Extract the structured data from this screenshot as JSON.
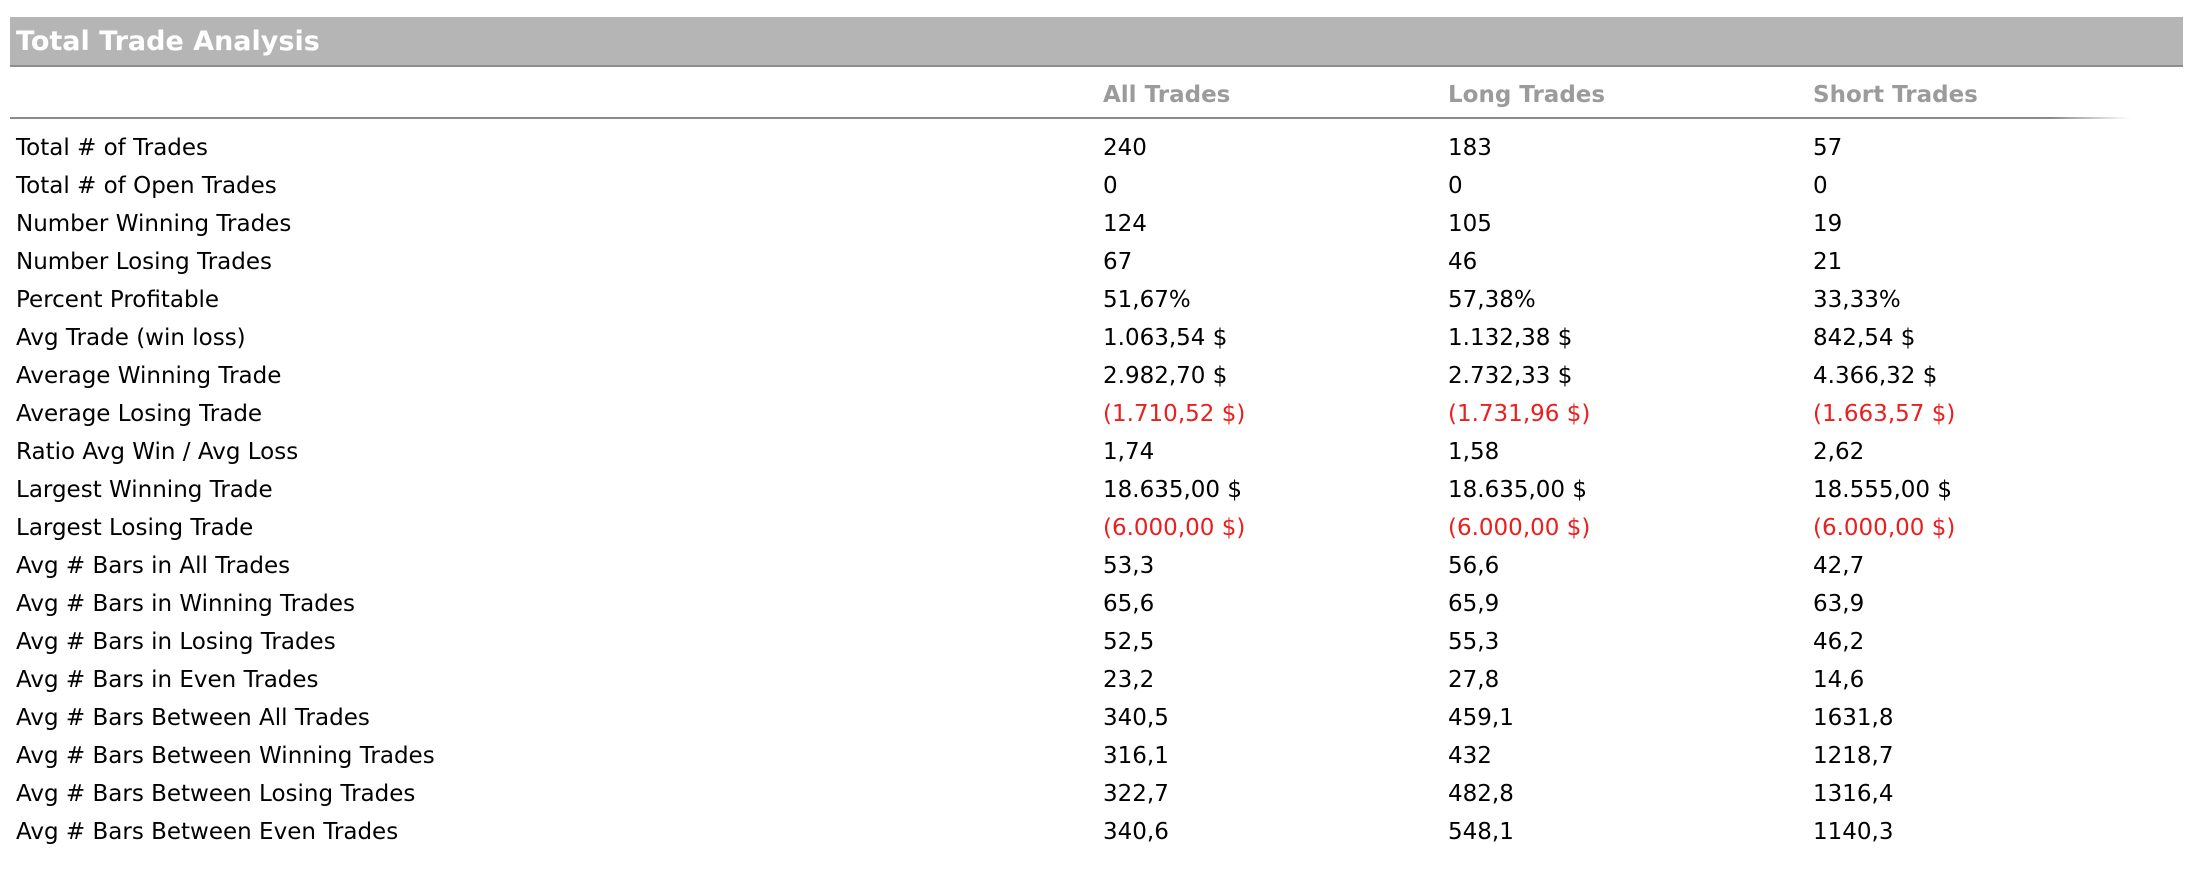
{
  "report": {
    "title": "Total Trade Analysis",
    "columns": [
      "All Trades",
      "Long Trades",
      "Short Trades"
    ],
    "negative_color": "#e8201f",
    "header_color": "#9b9b9b",
    "title_bar_color": "#b5b5b5",
    "rows": [
      {
        "label": "Total # of Trades",
        "values": [
          "240",
          "183",
          "57"
        ],
        "negative": false
      },
      {
        "label": "Total # of Open Trades",
        "values": [
          "0",
          "0",
          "0"
        ],
        "negative": false
      },
      {
        "label": "Number Winning Trades",
        "values": [
          "124",
          "105",
          "19"
        ],
        "negative": false
      },
      {
        "label": "Number Losing Trades",
        "values": [
          "67",
          "46",
          "21"
        ],
        "negative": false
      },
      {
        "label": "Percent Profitable",
        "values": [
          "51,67%",
          "57,38%",
          "33,33%"
        ],
        "negative": false
      },
      {
        "label": "Avg Trade (win  loss)",
        "values": [
          "1.063,54 $",
          "1.132,38 $",
          "842,54 $"
        ],
        "negative": false
      },
      {
        "label": "Average Winning Trade",
        "values": [
          "2.982,70 $",
          "2.732,33 $",
          "4.366,32 $"
        ],
        "negative": false
      },
      {
        "label": "Average Losing Trade",
        "values": [
          "(1.710,52 $)",
          "(1.731,96 $)",
          "(1.663,57 $)"
        ],
        "negative": true
      },
      {
        "label": "Ratio Avg Win / Avg Loss",
        "values": [
          "1,74",
          "1,58",
          "2,62"
        ],
        "negative": false
      },
      {
        "label": "Largest Winning Trade",
        "values": [
          "18.635,00 $",
          "18.635,00 $",
          "18.555,00 $"
        ],
        "negative": false
      },
      {
        "label": "Largest Losing Trade",
        "values": [
          "(6.000,00 $)",
          "(6.000,00 $)",
          "(6.000,00 $)"
        ],
        "negative": true
      },
      {
        "label": "Avg # Bars in All Trades",
        "values": [
          "53,3",
          "56,6",
          "42,7"
        ],
        "negative": false
      },
      {
        "label": "Avg # Bars in Winning Trades",
        "values": [
          "65,6",
          "65,9",
          "63,9"
        ],
        "negative": false
      },
      {
        "label": "Avg # Bars in Losing Trades",
        "values": [
          "52,5",
          "55,3",
          "46,2"
        ],
        "negative": false
      },
      {
        "label": "Avg # Bars in Even Trades",
        "values": [
          "23,2",
          "27,8",
          "14,6"
        ],
        "negative": false
      },
      {
        "label": "Avg # Bars Between All Trades",
        "values": [
          "340,5",
          "459,1",
          "1631,8"
        ],
        "negative": false
      },
      {
        "label": "Avg # Bars Between Winning Trades",
        "values": [
          "316,1",
          "432",
          "1218,7"
        ],
        "negative": false
      },
      {
        "label": "Avg # Bars Between Losing Trades",
        "values": [
          "322,7",
          "482,8",
          "1316,4"
        ],
        "negative": false
      },
      {
        "label": "Avg # Bars Between Even Trades",
        "values": [
          "340,6",
          "548,1",
          "1140,3"
        ],
        "negative": false
      }
    ]
  }
}
